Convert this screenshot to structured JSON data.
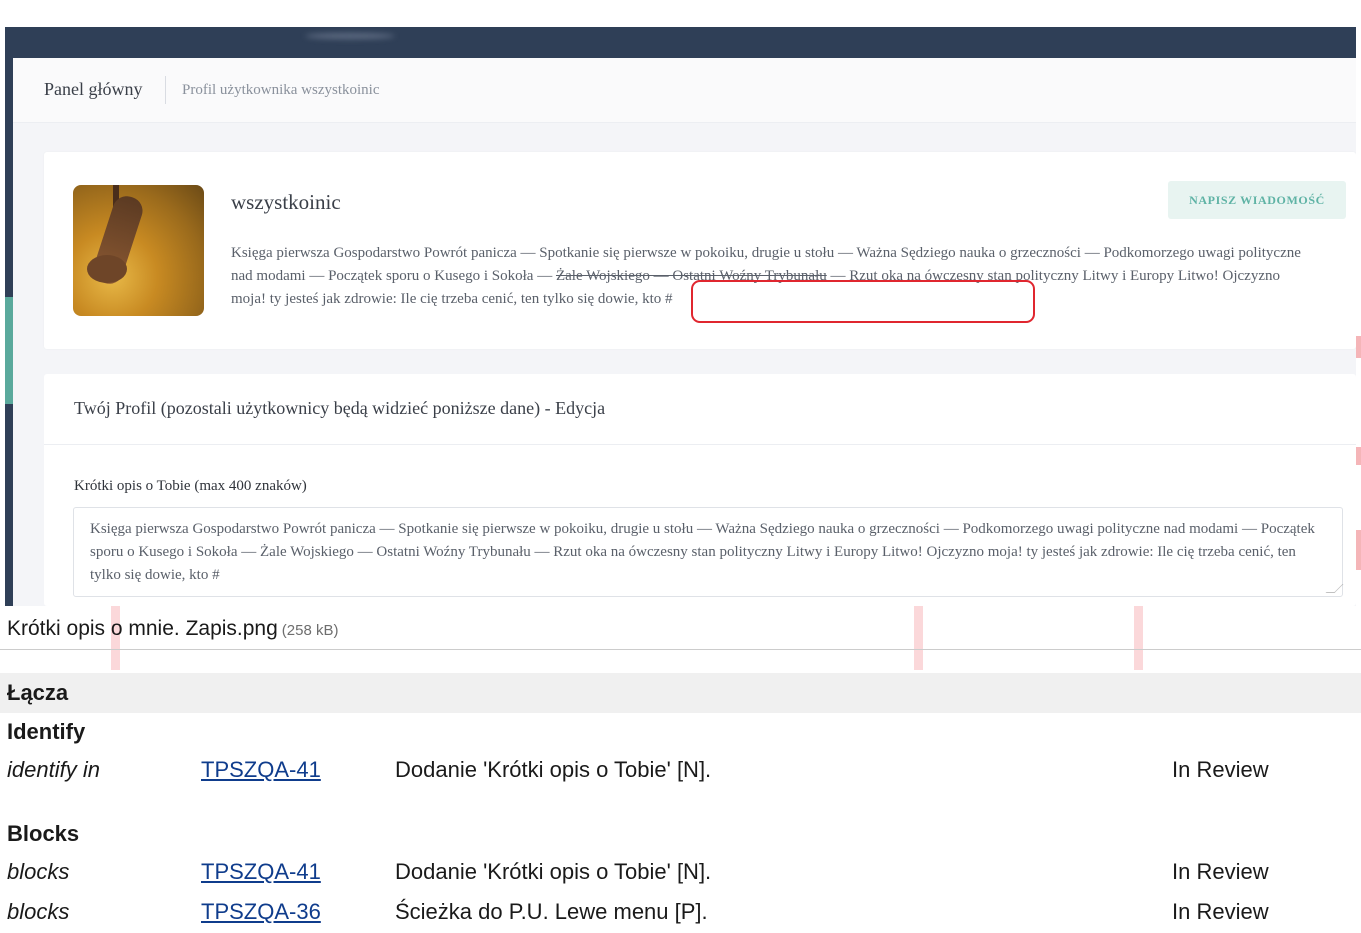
{
  "attachment": {
    "breadcrumb": {
      "main": "Panel główny",
      "sub": "Profil użytkownika wszystkoinic"
    },
    "profile": {
      "username": "wszystkoinic",
      "message_button": "NAPISZ WIADOMOŚĆ",
      "bio_part1": "Księga pierwsza Gospodarstwo Powrót panicza — Spotkanie się pierwsze w pokoiku, drugie u stołu — Ważna Sędziego nauka o grzeczności — Podkomorzego uwagi polityczne nad modami — Początek sporu o Kusego i Sokoła — ",
      "bio_strike": "Żale Wojskiego — Ostatni Woźny Trybunału",
      "bio_part2": " — Rzut oka na ówczesny stan polityczny Litwy i Europy Litwo! Ojczyzno moja! ty jesteś jak zdrowie: Ile cię trzeba cenić, ten tylko się dowie, kto #"
    },
    "edit_card": {
      "title": "Twój Profil (pozostali użytkownicy będą widzieć poniższe dane) - Edycja",
      "field_label": "Krótki opis o Tobie (max 400 znaków)",
      "field_value": "Księga pierwsza Gospodarstwo Powrót panicza — Spotkanie się pierwsze w pokoiku, drugie u stołu — Ważna Sędziego nauka o grzeczności — Podkomorzego uwagi polityczne nad modami — Początek sporu o Kusego i Sokoła — Żale Wojskiego — Ostatni Woźny Trybunału — Rzut oka na ówczesny stan polityczny Litwy i Europy Litwo! Ojczyzno moja! ty jesteś jak zdrowie: Ile cię trzeba cenić, ten tylko się dowie, kto #"
    },
    "caption": {
      "filename": "Krótki opis o mnie. Zapis.png",
      "size": "(258 kB)"
    }
  },
  "links": {
    "header": "Łącza",
    "groups": [
      {
        "title": "Identify",
        "rows": [
          {
            "type": "identify in",
            "key": "TPSZQA-41",
            "summary": "Dodanie 'Krótki opis o Tobie' [N].",
            "status": "In Review"
          }
        ]
      },
      {
        "title": "Blocks",
        "rows": [
          {
            "type": "blocks",
            "key": "TPSZQA-41",
            "summary": "Dodanie 'Krótki opis o Tobie' [N].",
            "status": "In Review"
          },
          {
            "type": "blocks",
            "key": "TPSZQA-36",
            "summary": "Ścieżka do P.U. Lewe menu [P].",
            "status": "In Review"
          }
        ]
      }
    ]
  },
  "colors": {
    "topbar": "#2f3f57",
    "accent": "#5fb3a5",
    "highlight_box": "#e0262f",
    "link": "#0f3c8c"
  }
}
